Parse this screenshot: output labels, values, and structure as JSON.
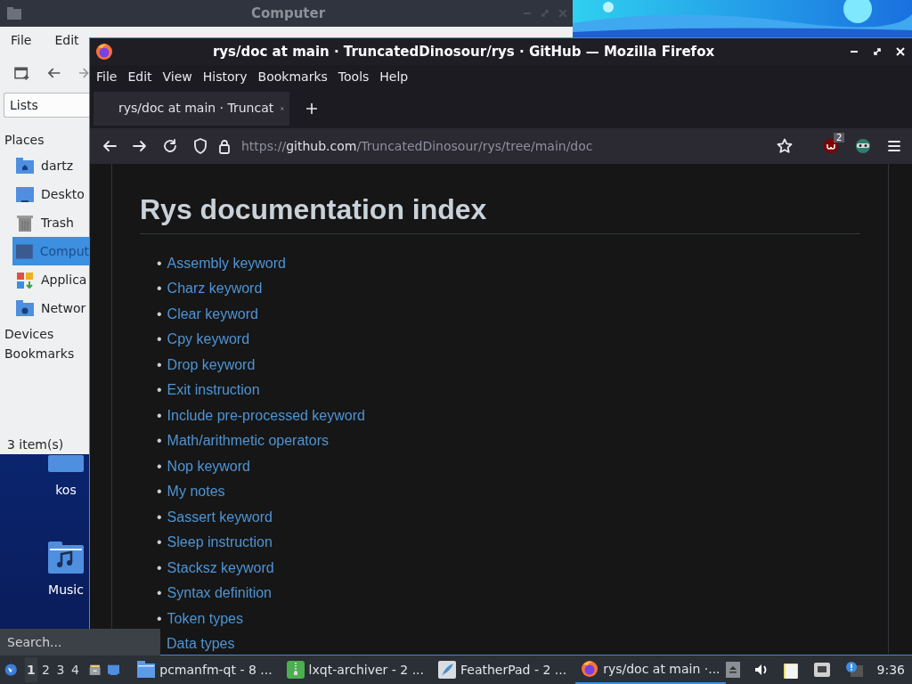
{
  "file_manager": {
    "title": "Computer",
    "menu": [
      "File",
      "Edit"
    ],
    "places_combo": "Lists",
    "sections": [
      {
        "label": "Places",
        "items": [
          {
            "label": "dartz",
            "kind": "home",
            "selected": false
          },
          {
            "label": "Deskto",
            "kind": "desktop",
            "selected": false
          },
          {
            "label": "Trash",
            "kind": "trash",
            "selected": false
          },
          {
            "label": "Comput",
            "kind": "computer",
            "selected": true
          },
          {
            "label": "Applica",
            "kind": "apps",
            "selected": false
          },
          {
            "label": "Networ",
            "kind": "network",
            "selected": false
          }
        ]
      },
      {
        "label": "Devices"
      },
      {
        "label": "Bookmarks"
      }
    ],
    "status": "3 item(s)"
  },
  "desktop_icons": [
    {
      "label": "kos",
      "kind": "folder"
    },
    {
      "label": "Music",
      "kind": "music"
    }
  ],
  "browser": {
    "title": "rys/doc at main · TruncatedDinosour/rys · GitHub — Mozilla Firefox",
    "menu": [
      "File",
      "Edit",
      "View",
      "History",
      "Bookmarks",
      "Tools",
      "Help"
    ],
    "tabs": [
      {
        "label": "rys/doc at main · Truncat",
        "selected": true
      }
    ],
    "url": {
      "scheme": "https://",
      "host": "github.com",
      "path": "/TruncatedDinosour/rys/tree/main/doc"
    },
    "extension_badge": "2",
    "page": {
      "heading": "Rys documentation index",
      "links": [
        {
          "marker": "•",
          "text": "Assembly keyword"
        },
        {
          "marker": "•",
          "text": "Charz keyword"
        },
        {
          "marker": "•",
          "text": "Clear keyword"
        },
        {
          "marker": "•",
          "text": "Cpy keyword"
        },
        {
          "marker": "•",
          "text": "Drop keyword"
        },
        {
          "marker": "•",
          "text": "Exit instruction"
        },
        {
          "marker": "•",
          "text": "Include pre-processed keyword"
        },
        {
          "marker": "•",
          "text": "Math/arithmetic operators"
        },
        {
          "marker": "•",
          "text": "Nop keyword"
        },
        {
          "marker": "•",
          "text": "My notes"
        },
        {
          "marker": "•",
          "text": "Sassert keyword"
        },
        {
          "marker": "•",
          "text": "Sleep instruction"
        },
        {
          "marker": "•",
          "text": "Stacksz keyword"
        },
        {
          "marker": "•",
          "text": "Syntax definition"
        },
        {
          "marker": "•",
          "text": "Token types"
        },
        {
          "text": "Data types"
        }
      ]
    }
  },
  "launcher_search": {
    "placeholder": "Search..."
  },
  "taskbar": {
    "desktops": [
      {
        "label": "1",
        "selected": true
      },
      {
        "label": "2",
        "selected": false
      },
      {
        "label": "3",
        "selected": false
      },
      {
        "label": "4",
        "selected": false
      }
    ],
    "tasks": [
      {
        "label": "pcmanfm-qt - 8 ...",
        "kind": "folder",
        "selected": false
      },
      {
        "label": "lxqt-archiver - 2 ...",
        "kind": "archive",
        "selected": false
      },
      {
        "label": "FeatherPad - 2 ...",
        "kind": "editor",
        "selected": false
      },
      {
        "label": "rys/doc at main ·...",
        "kind": "browser",
        "selected": true
      }
    ],
    "clock": "9:36"
  }
}
